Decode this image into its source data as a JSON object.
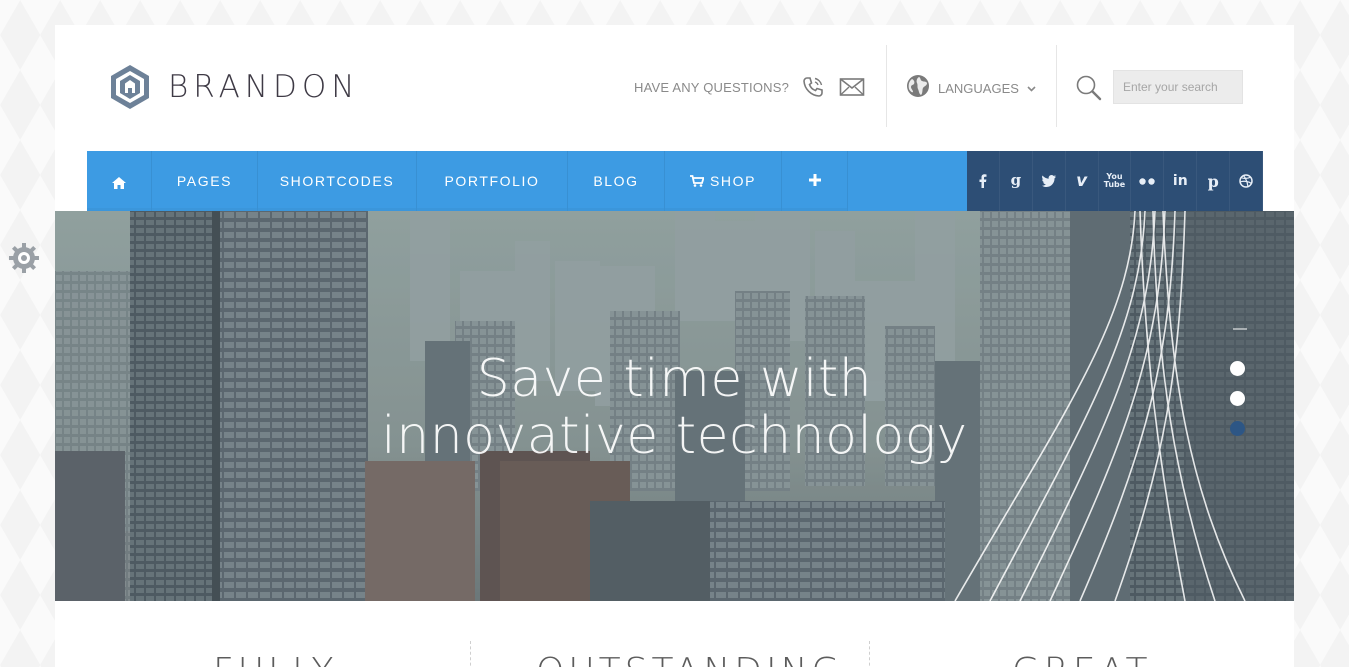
{
  "brand": {
    "name": "BRANDON"
  },
  "header": {
    "contact_label": "HAVE ANY QUESTIONS?",
    "languages_label": "LANGUAGES",
    "search_placeholder": "Enter your search"
  },
  "nav": {
    "items": [
      {
        "label": "",
        "icon": "home-icon"
      },
      {
        "label": "PAGES"
      },
      {
        "label": "SHORTCODES"
      },
      {
        "label": "PORTFOLIO"
      },
      {
        "label": "BLOG"
      },
      {
        "label": "SHOP",
        "icon": "cart-icon"
      },
      {
        "label": "",
        "icon": "plus-icon"
      }
    ],
    "social": [
      "facebook-icon",
      "google-icon",
      "twitter-icon",
      "vimeo-icon",
      "youtube-icon",
      "flickr-icon",
      "linkedin-icon",
      "pinterest-icon",
      "dribbble-icon"
    ]
  },
  "hero": {
    "title_line1": "Save time with",
    "title_line2": "innovative technology",
    "slide_count": 3,
    "active_slide": 3
  },
  "features": {
    "titles": [
      "FULLY",
      "OUTSTANDING",
      "GREAT"
    ]
  },
  "colors": {
    "nav_blue": "#3d9be3",
    "social_navy": "#2d4e75",
    "brand_text": "#3e3a45",
    "slide_active": "#2d5685"
  }
}
